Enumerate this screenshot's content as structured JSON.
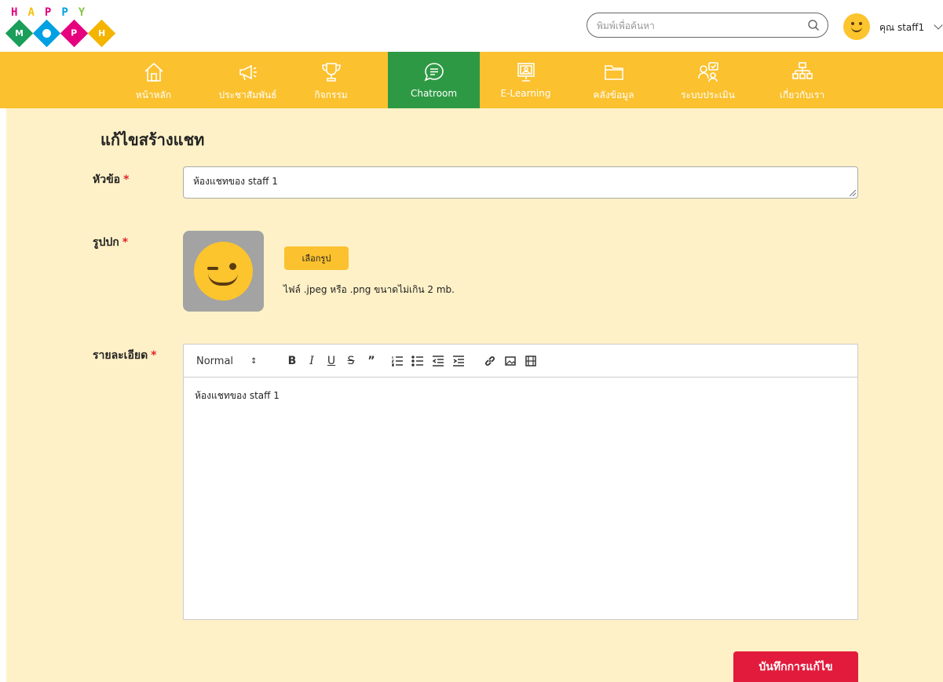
{
  "logo": {
    "letters": [
      "H",
      "A",
      "P",
      "P",
      "Y"
    ],
    "word": [
      "M",
      "O",
      "P",
      "H"
    ]
  },
  "header": {
    "search_placeholder": "พิมพ์เพื่อค้นหา",
    "username": "คุณ staff1"
  },
  "nav": {
    "items": [
      {
        "label": "หน้าหลัก",
        "icon": "home-icon"
      },
      {
        "label": "ประชาสัมพันธ์",
        "icon": "megaphone-icon"
      },
      {
        "label": "กิจกรรม",
        "icon": "trophy-icon"
      },
      {
        "label": "Chatroom",
        "icon": "chat-icon",
        "active": true
      },
      {
        "label": "E-Learning",
        "icon": "monitor-icon"
      },
      {
        "label": "คลังข้อมูล",
        "icon": "folder-icon"
      },
      {
        "label": "ระบบประเมิน",
        "icon": "evaluation-icon"
      },
      {
        "label": "เกี่ยวกับเรา",
        "icon": "org-chart-icon"
      }
    ],
    "active_color": "#2e9945",
    "bar_color": "#fbc12e"
  },
  "form": {
    "title": "แก้ไขสร้างแชท",
    "topic_label": "หัวข้อ",
    "topic_value": "ห้องแชทของ staff 1",
    "cover_label": "รูปปก",
    "pick_button": "เลือกรูป",
    "file_hint": "ไฟล์ .jpeg หรือ .png ขนาดไม่เกิน 2 mb.",
    "detail_label": "รายละเอียด",
    "required_mark": "*",
    "editor": {
      "format_select": "Normal",
      "toolbar_icons": [
        "bold-icon",
        "italic-icon",
        "underline-icon",
        "strikethrough-icon",
        "blockquote-icon",
        "ordered-list-icon",
        "bullet-list-icon",
        "outdent-icon",
        "indent-icon",
        "link-icon",
        "image-icon",
        "video-icon"
      ],
      "content": "ห้องแชทของ staff 1"
    },
    "save_button": "บันทึกการแก้ไข"
  },
  "colors": {
    "page_bg": "#fff1c7",
    "save": "#e21b3c",
    "required": "#e0242f"
  }
}
